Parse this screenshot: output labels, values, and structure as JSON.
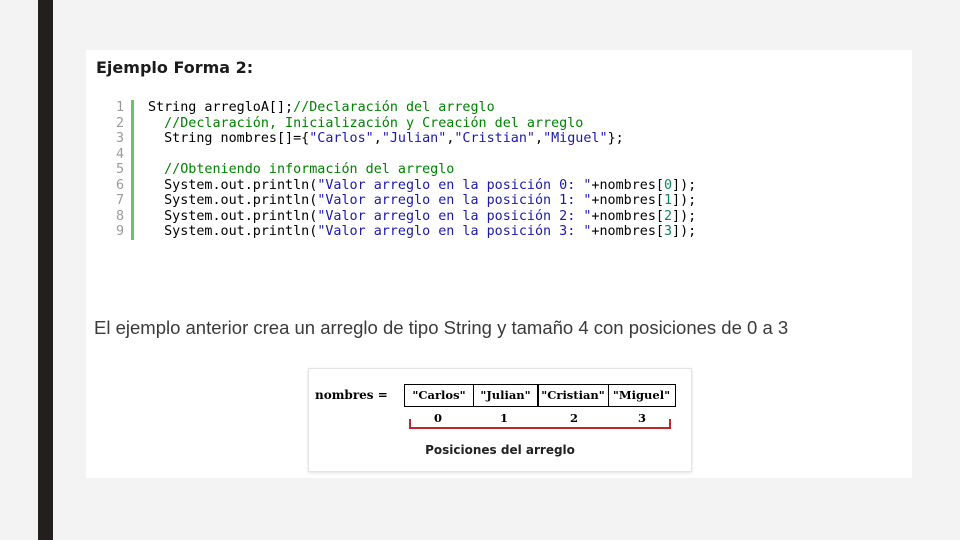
{
  "heading": "Ejemplo Forma 2:",
  "code_lines": [
    {
      "n": "1",
      "tokens": [
        {
          "t": "String arregloA[];",
          "c": "src"
        },
        {
          "t": "//Declaración del arreglo",
          "c": "tok-comment"
        }
      ]
    },
    {
      "n": "2",
      "tokens": [
        {
          "t": "  ",
          "c": "src"
        },
        {
          "t": "//Declaración, Inicialización y Creación del arreglo",
          "c": "tok-comment"
        }
      ]
    },
    {
      "n": "3",
      "tokens": [
        {
          "t": "  String nombres[]={",
          "c": "src"
        },
        {
          "t": "\"Carlos\"",
          "c": "tok-string"
        },
        {
          "t": ",",
          "c": "src"
        },
        {
          "t": "\"Julian\"",
          "c": "tok-string"
        },
        {
          "t": ",",
          "c": "src"
        },
        {
          "t": "\"Cristian\"",
          "c": "tok-string"
        },
        {
          "t": ",",
          "c": "src"
        },
        {
          "t": "\"Miguel\"",
          "c": "tok-string"
        },
        {
          "t": "};",
          "c": "src"
        }
      ]
    },
    {
      "n": "4",
      "tokens": []
    },
    {
      "n": "5",
      "tokens": [
        {
          "t": "  ",
          "c": "src"
        },
        {
          "t": "//Obteniendo información del arreglo",
          "c": "tok-comment"
        }
      ]
    },
    {
      "n": "6",
      "tokens": [
        {
          "t": "  System.out.println(",
          "c": "src"
        },
        {
          "t": "\"Valor arreglo en la posición 0: \"",
          "c": "tok-string"
        },
        {
          "t": "+nombres[",
          "c": "src"
        },
        {
          "t": "0",
          "c": "tok-num"
        },
        {
          "t": "]);",
          "c": "src"
        }
      ]
    },
    {
      "n": "7",
      "tokens": [
        {
          "t": "  System.out.println(",
          "c": "src"
        },
        {
          "t": "\"Valor arreglo en la posición 1: \"",
          "c": "tok-string"
        },
        {
          "t": "+nombres[",
          "c": "src"
        },
        {
          "t": "1",
          "c": "tok-num"
        },
        {
          "t": "]);",
          "c": "src"
        }
      ]
    },
    {
      "n": "8",
      "tokens": [
        {
          "t": "  System.out.println(",
          "c": "src"
        },
        {
          "t": "\"Valor arreglo en la posición 2: \"",
          "c": "tok-string"
        },
        {
          "t": "+nombres[",
          "c": "src"
        },
        {
          "t": "2",
          "c": "tok-num"
        },
        {
          "t": "]);",
          "c": "src"
        }
      ]
    },
    {
      "n": "9",
      "tokens": [
        {
          "t": "  System.out.println(",
          "c": "src"
        },
        {
          "t": "\"Valor arreglo en la posición 3: \"",
          "c": "tok-string"
        },
        {
          "t": "+nombres[",
          "c": "src"
        },
        {
          "t": "3",
          "c": "tok-num"
        },
        {
          "t": "]);",
          "c": "src"
        }
      ]
    }
  ],
  "description": "El ejemplo anterior crea un arreglo de tipo String y tamaño 4 con posiciones de 0 a 3",
  "figure": {
    "label": "nombres =",
    "cells": [
      "\"Carlos\"",
      "\"Julian\"",
      "\"Cristian\"",
      "\"Miguel\""
    ],
    "indices": [
      "0",
      "1",
      "2",
      "3"
    ],
    "caption": "Posiciones del arreglo"
  },
  "colors": {
    "background": "#f3f3f3",
    "accent_bar": "#231f1b",
    "gutter": "#6ac36a",
    "comment": "#008200",
    "string": "#1a1aa6",
    "bracket_line": "#c0272d"
  }
}
